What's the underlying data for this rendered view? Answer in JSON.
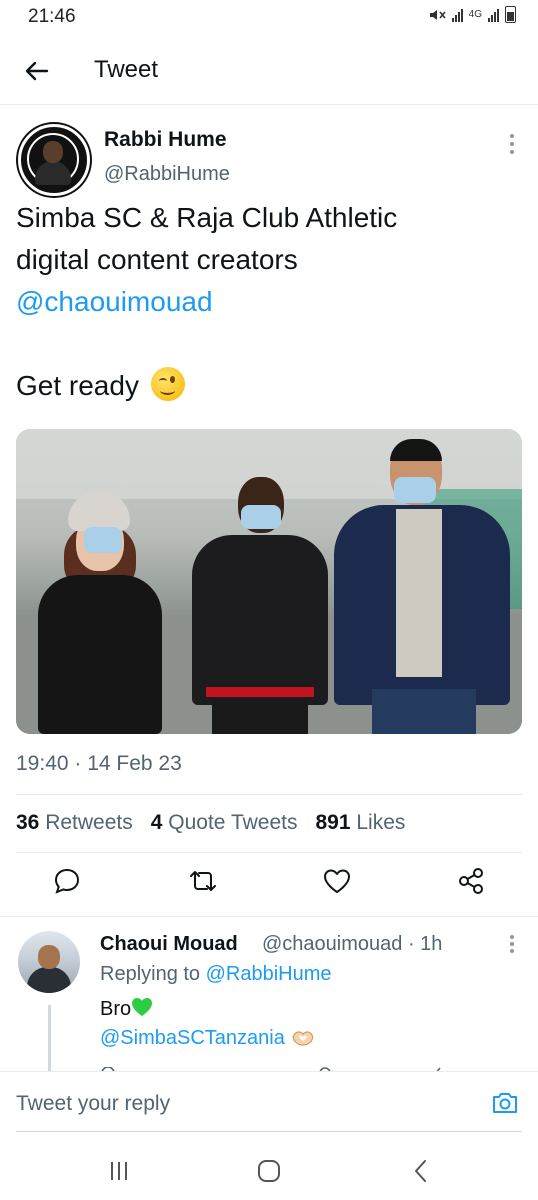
{
  "status_bar": {
    "time": "21:46",
    "network": "4G"
  },
  "header": {
    "title": "Tweet"
  },
  "tweet": {
    "author_name": "Rabbi Hume",
    "author_handle": "@RabbiHume",
    "text_line1": "Simba SC & Raja Club Athletic",
    "text_line2": "digital content creators",
    "mention": "@chaouimouad",
    "text_line3": "Get ready",
    "timestamp": "19:40 · 14 Feb 23",
    "retweets_count": "36",
    "retweets_label": "Retweets",
    "quotes_count": "4",
    "quotes_label": "Quote Tweets",
    "likes_count": "891",
    "likes_label": "Likes"
  },
  "reply": {
    "author_name": "Chaoui Mouad",
    "meta": "@chaouimouad · 1h",
    "replying_prefix": "Replying to",
    "replying_to": "@RabbiHume",
    "text": "Bro",
    "mention": "@SimbaSCTanzania"
  },
  "composer": {
    "placeholder": "Tweet your reply"
  },
  "colors": {
    "accent": "#1d9bf0",
    "heart_emoji": "#2ecc40"
  },
  "icons": [
    "back-arrow-icon",
    "more-icon",
    "wink-emoji-icon",
    "reply-icon",
    "retweet-icon",
    "like-icon",
    "share-icon",
    "green-heart-emoji-icon",
    "heart-hands-emoji-icon",
    "camera-icon",
    "recents-icon",
    "home-icon",
    "back-nav-icon"
  ]
}
